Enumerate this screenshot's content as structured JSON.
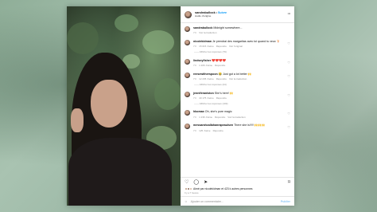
{
  "header": {
    "username": "sandrabullock",
    "dot": "•",
    "follow": "Suivre",
    "subtitle": "Audio d'origine",
    "more": "···"
  },
  "caption": {
    "username": "sandrabullock",
    "text": "Midnight somewhere...",
    "time": "7 h",
    "translate": "Voir la traduction"
  },
  "comments": [
    {
      "username": "nicolekidman",
      "text": "Je prendrai des margaritas avec toi quand tu veux 🍹",
      "time": "7 h",
      "likes": "15 015 J'aime",
      "reply": "Répondre",
      "extra": "Voir l'original",
      "replies": "—— Afficher les réponses (79)"
    },
    {
      "username": "lindseyfisher",
      "text": "❤️❤️❤️❤️",
      "time": "7 h",
      "likes": "1 206 J'aime",
      "reply": "Répondre",
      "extra": "",
      "replies": ""
    },
    {
      "username": "reesewitherspoon",
      "text": "😂 Just got a lot better 🙌",
      "time": "7 h",
      "likes": "12 235 J'aime",
      "reply": "Répondre",
      "extra": "Voir la traduction",
      "replies": "—— Afficher les réponses (24)"
    },
    {
      "username": "jenniferaniston",
      "text": "She's here! 🙌",
      "time": "7 h",
      "likes": "40 175 J'aime",
      "reply": "Répondre",
      "extra": "",
      "replies": "—— Afficher les réponses (109)"
    },
    {
      "username": "hbomax",
      "text": "Oh, she's pure magic",
      "time": "7 h",
      "likes": "1 236 J'aime",
      "reply": "Répondre",
      "extra": "Voir la traduction",
      "replies": ""
    },
    {
      "username": "messarahcallahanrapeaulsen",
      "text": "There she is!!!!! 🙌🙌🙌",
      "time": "7 h",
      "likes": "125 J'aime",
      "reply": "Répondre",
      "extra": "",
      "replies": ""
    }
  ],
  "icons": {
    "heart": "♡",
    "comment": "◯",
    "share": "➤",
    "save": "⌑",
    "emoji": "☺"
  },
  "likes_text": "Aimé par nicolekidman et 423 k autres personnes",
  "date": "Il y a 7 heures",
  "add_comment": {
    "placeholder": "Ajouter un commentaire...",
    "publish": "Publier"
  }
}
